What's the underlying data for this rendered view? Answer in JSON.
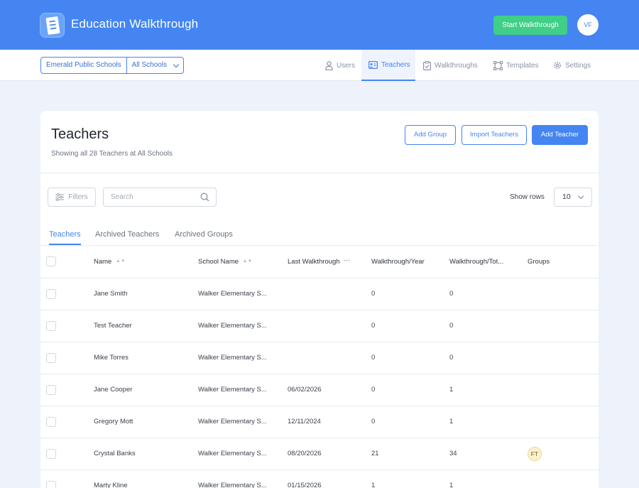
{
  "app": {
    "title": "Education Walkthrough",
    "start_button": "Start Walkthrough",
    "avatar_initials": "VF"
  },
  "school_picker": {
    "org": "Emerald Public Schools",
    "scope": "All Schools"
  },
  "nav": [
    {
      "label": "Users",
      "icon": "user-icon",
      "active": false
    },
    {
      "label": "Teachers",
      "icon": "id-card-icon",
      "active": true
    },
    {
      "label": "Walkthroughs",
      "icon": "clipboard-check-icon",
      "active": false
    },
    {
      "label": "Templates",
      "icon": "template-icon",
      "active": false
    },
    {
      "label": "Settings",
      "icon": "gear-icon",
      "active": false
    }
  ],
  "page": {
    "title": "Teachers",
    "subtitle": "Showing all 28 Teachers at All Schools",
    "add_group": "Add Group",
    "import_teachers": "Import Teachers",
    "add_teacher": "Add Teacher"
  },
  "toolbar": {
    "filters": "Filters",
    "search_placeholder": "Search",
    "show_rows_label": "Show rows",
    "rows_value": "10"
  },
  "tabs": [
    {
      "label": "Teachers",
      "active": true
    },
    {
      "label": "Archived Teachers",
      "active": false
    },
    {
      "label": "Archived Groups",
      "active": false
    }
  ],
  "table": {
    "headers": {
      "name": "Name",
      "school": "School Name",
      "last": "Last Walkthrough",
      "year": "Walkthrough/Year",
      "total": "Walkthrough/Tot...",
      "groups": "Groups"
    },
    "rows": [
      {
        "name": "Jane Smith",
        "school": "Walker Elementary S...",
        "last": "",
        "year": "0",
        "total": "0",
        "group": ""
      },
      {
        "name": "Test Teacher",
        "school": "Walker Elementary S...",
        "last": "",
        "year": "0",
        "total": "0",
        "group": ""
      },
      {
        "name": "Mike Torres",
        "school": "Walker Elementary S...",
        "last": "",
        "year": "0",
        "total": "0",
        "group": ""
      },
      {
        "name": "Jane Cooper",
        "school": "Walker Elementary S...",
        "last": "06/02/2026",
        "year": "0",
        "total": "1",
        "group": ""
      },
      {
        "name": "Gregory Mott",
        "school": "Walker Elementary S...",
        "last": "12/11/2024",
        "year": "0",
        "total": "1",
        "group": ""
      },
      {
        "name": "Crystal Banks",
        "school": "Walker Elementary S...",
        "last": "08/20/2026",
        "year": "21",
        "total": "34",
        "group": "FT"
      },
      {
        "name": "Marty Kline",
        "school": "Walker Elementary S...",
        "last": "01/15/2026",
        "year": "1",
        "total": "1",
        "group": ""
      }
    ]
  }
}
